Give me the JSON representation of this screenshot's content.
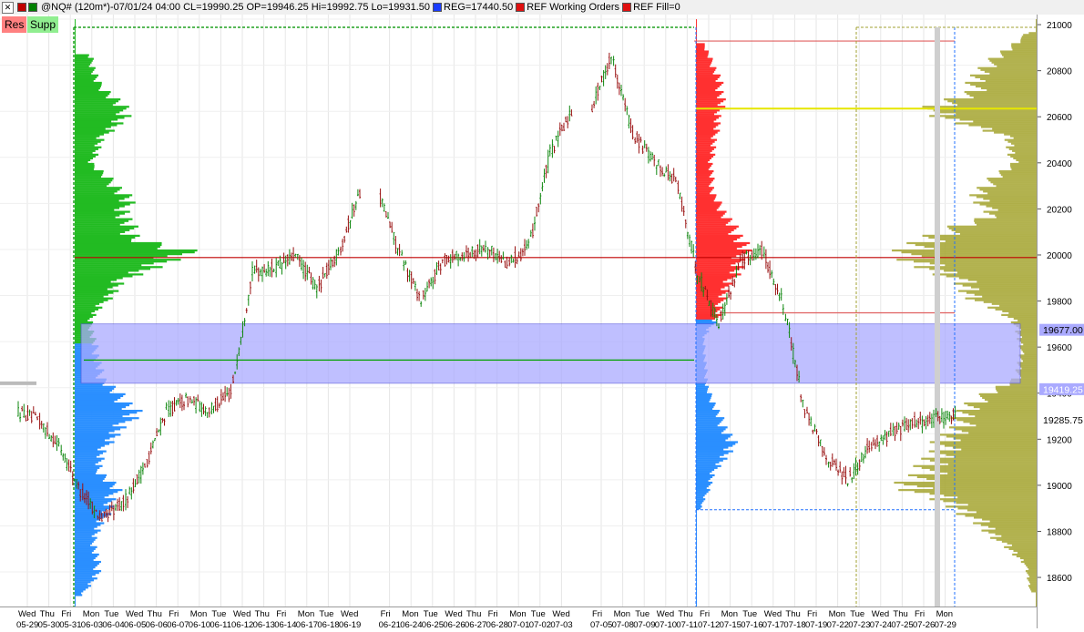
{
  "header": {
    "title": "@NQ# (120m*)-07/01/24 04:00 CL=19990.25 OP=19946.25 Hi=19992.75 Lo=19931.50",
    "reg_label": "REG=17440.50",
    "ref_orders_label": "REF Working Orders",
    "ref_fill_label": "REF Fill=0",
    "close_glyph": "✕",
    "colors": {
      "reg": "#1a3cff",
      "ref": "#e01010",
      "icon1": "#c00000",
      "icon2": "#008000"
    }
  },
  "buttons": {
    "res": {
      "label": "Res",
      "color": "#ff8080"
    },
    "supp": {
      "label": "Supp",
      "color": "#90ee90"
    }
  },
  "price_markers": {
    "upper": "19677.00",
    "lower": "19419.25",
    "current": "19285.75"
  },
  "chart_data": {
    "type": "candlestick",
    "ylim": [
      18450,
      21020
    ],
    "y_ticks": [
      18600,
      18800,
      19000,
      19200,
      19400,
      19600,
      19800,
      20000,
      20200,
      20400,
      20600,
      20800,
      21000
    ],
    "grid": true,
    "day_labels": [
      "Wed",
      "Thu",
      "Fri",
      "Mon",
      "Tue",
      "Wed",
      "Thu",
      "Fri",
      "Mon",
      "Tue",
      "Wed",
      "Thu",
      "Fri",
      "Mon",
      "Tue",
      "Wed",
      "Fri",
      "Mon",
      "Tue",
      "Wed",
      "Thu",
      "Fri",
      "Mon",
      "Tue",
      "Wed",
      "Fri",
      "Mon",
      "Tue",
      "Wed",
      "Thu",
      "Fri",
      "Mon",
      "Tue",
      "Wed",
      "Thu",
      "Fri",
      "Mon",
      "Tue",
      "Wed",
      "Thu",
      "Fri",
      "Mon"
    ],
    "date_labels": [
      "05-29",
      "05-30",
      "05-31",
      "06-03",
      "06-04",
      "06-05",
      "06-06",
      "06-07",
      "06-10",
      "06-11",
      "06-12",
      "06-13",
      "06-14",
      "06-17",
      "06-18",
      "06-19",
      "06-21",
      "06-24",
      "06-25",
      "06-26",
      "06-27",
      "06-28",
      "07-01",
      "07-02",
      "07-03",
      "07-05",
      "07-08",
      "07-09",
      "07-10",
      "07-11",
      "07-12",
      "07-15",
      "07-16",
      "07-17",
      "07-18",
      "07-19",
      "07-22",
      "07-23",
      "07-24",
      "07-25",
      "07-26",
      "07-29"
    ],
    "day_gap_after": [
      15,
      24
    ],
    "closes": [
      19260,
      19150,
      18950,
      18830,
      18900,
      19060,
      19300,
      19350,
      19300,
      19380,
      19900,
      19920,
      19970,
      19830,
      19990,
      20250,
      19980,
      19780,
      19950,
      19980,
      20010,
      19940,
      20010,
      20420,
      20600,
      20840,
      20500,
      20380,
      20300,
      19900,
      19680,
      19950,
      20000,
      19760,
      19300,
      19100,
      19000,
      19150,
      19200,
      19250,
      19260,
      19285.75
    ],
    "ranges": [
      {
        "price": 19677.0,
        "role": "upper"
      },
      {
        "price": 19419.25,
        "role": "lower"
      }
    ],
    "zone": [
      19419.25,
      19677.0
    ],
    "levels": [
      {
        "price": 19965,
        "color": "#c00000"
      },
      {
        "price": 20612,
        "color": "#e6e600"
      },
      {
        "price": 20905,
        "color": "#e06060"
      },
      {
        "price": 19725,
        "color": "#e06060"
      },
      {
        "price": 19520,
        "color": "#00a000"
      }
    ],
    "profiles": [
      {
        "name": "",
        "color_above": "#22bb22",
        "color_below": "#2a8fff",
        "split": 19600,
        "bands": [
          {
            "p": 20850,
            "w": 20
          },
          {
            "p": 20730,
            "w": 30
          },
          {
            "p": 20650,
            "w": 55
          },
          {
            "p": 20590,
            "w": 70
          },
          {
            "p": 20500,
            "w": 38
          },
          {
            "p": 20380,
            "w": 22
          },
          {
            "p": 20230,
            "w": 70
          },
          {
            "p": 20150,
            "w": 65
          },
          {
            "p": 20050,
            "w": 80
          },
          {
            "p": 19990,
            "w": 150
          },
          {
            "p": 19880,
            "w": 65
          },
          {
            "p": 19780,
            "w": 40
          },
          {
            "p": 19700,
            "w": 20
          },
          {
            "p": 19450,
            "w": 35
          },
          {
            "p": 19300,
            "w": 80
          },
          {
            "p": 19150,
            "w": 40
          },
          {
            "p": 19050,
            "w": 30
          },
          {
            "p": 18970,
            "w": 55
          },
          {
            "p": 18880,
            "w": 45
          },
          {
            "p": 18750,
            "w": 25
          },
          {
            "p": 18600,
            "w": 32
          },
          {
            "p": 18500,
            "w": 8
          }
        ]
      },
      {
        "name": "",
        "color_above": "#ff3030",
        "color_below": "#2a8fff",
        "split": 19700,
        "bands": [
          {
            "p": 20900,
            "w": 10
          },
          {
            "p": 20750,
            "w": 30
          },
          {
            "p": 20650,
            "w": 35
          },
          {
            "p": 20580,
            "w": 30
          },
          {
            "p": 20480,
            "w": 25
          },
          {
            "p": 20380,
            "w": 20
          },
          {
            "p": 20250,
            "w": 22
          },
          {
            "p": 20120,
            "w": 45
          },
          {
            "p": 20020,
            "w": 65
          },
          {
            "p": 19920,
            "w": 55
          },
          {
            "p": 19800,
            "w": 35
          },
          {
            "p": 19720,
            "w": 30
          },
          {
            "p": 19620,
            "w": 10
          },
          {
            "p": 19400,
            "w": 15
          },
          {
            "p": 19250,
            "w": 35
          },
          {
            "p": 19150,
            "w": 50
          },
          {
            "p": 19050,
            "w": 25
          },
          {
            "p": 18950,
            "w": 15
          },
          {
            "p": 18880,
            "w": 6
          }
        ]
      },
      {
        "name": "",
        "color_above": "#a5a530",
        "color_below": "#a5a530",
        "split": 0,
        "right_anchored": true,
        "bands": [
          {
            "p": 20950,
            "w": 10
          },
          {
            "p": 20870,
            "w": 40
          },
          {
            "p": 20780,
            "w": 75
          },
          {
            "p": 20690,
            "w": 85
          },
          {
            "p": 20600,
            "w": 145
          },
          {
            "p": 20500,
            "w": 40
          },
          {
            "p": 20380,
            "w": 30
          },
          {
            "p": 20250,
            "w": 80
          },
          {
            "p": 20150,
            "w": 60
          },
          {
            "p": 20060,
            "w": 140
          },
          {
            "p": 19970,
            "w": 175
          },
          {
            "p": 19880,
            "w": 105
          },
          {
            "p": 19800,
            "w": 85
          },
          {
            "p": 19700,
            "w": 30
          },
          {
            "p": 19580,
            "w": 20
          },
          {
            "p": 19450,
            "w": 25
          },
          {
            "p": 19330,
            "w": 90
          },
          {
            "p": 19250,
            "w": 100
          },
          {
            "p": 19150,
            "w": 125
          },
          {
            "p": 19060,
            "w": 140
          },
          {
            "p": 18980,
            "w": 170
          },
          {
            "p": 18880,
            "w": 100
          },
          {
            "p": 18760,
            "w": 55
          },
          {
            "p": 18640,
            "w": 15
          },
          {
            "p": 18520,
            "w": 8
          }
        ]
      }
    ]
  }
}
